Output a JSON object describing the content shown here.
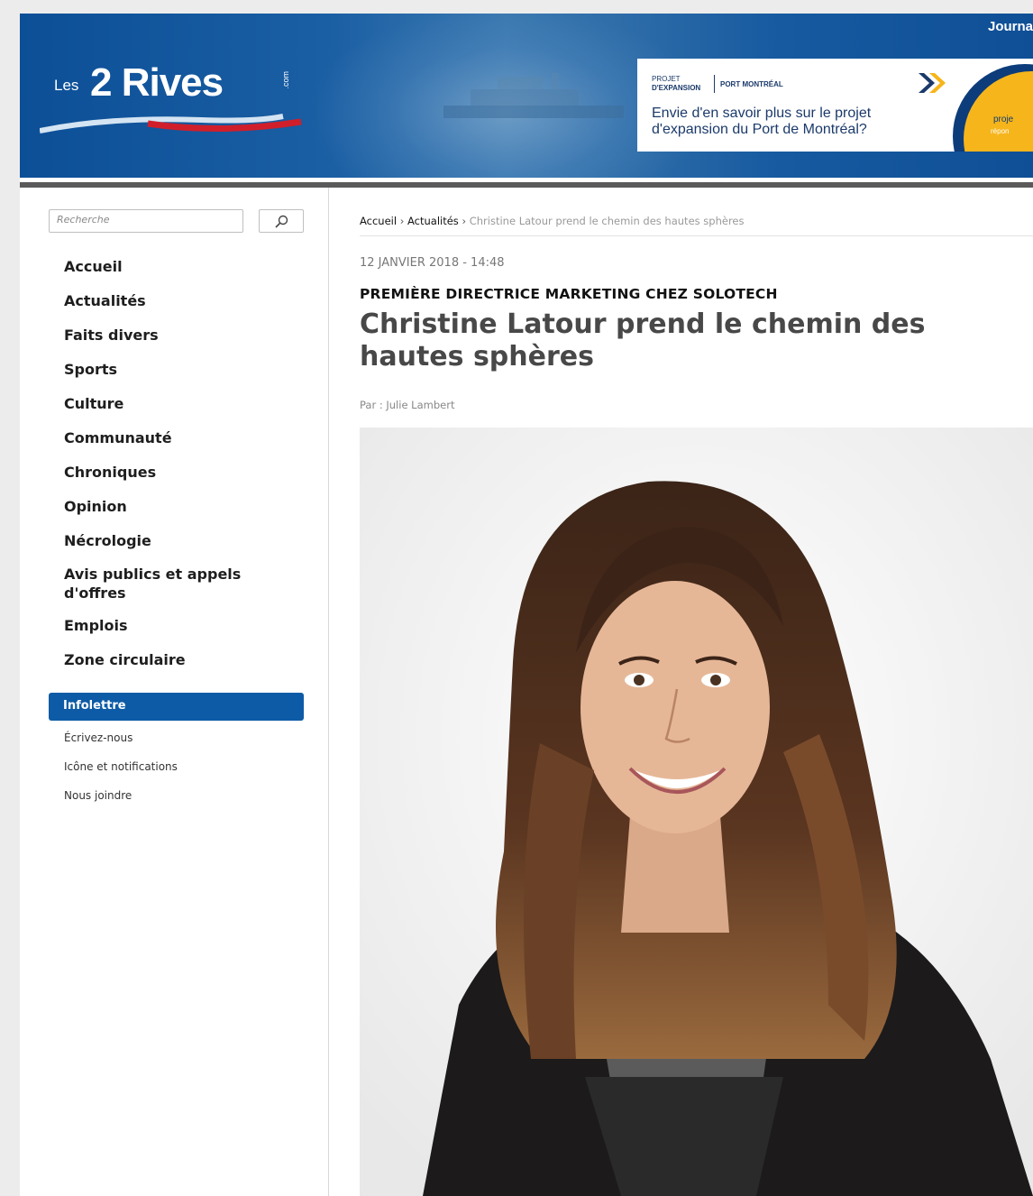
{
  "header": {
    "logo_les": "Les",
    "logo_main": "2 Rives",
    "logo_com": ".com",
    "top_right_label": "Journa",
    "ad": {
      "projet_line1": "PROJET",
      "projet_line2": "D'EXPANSION",
      "port_label": "PORT MONTRÉAL",
      "text": "Envie d'en savoir plus sur le projet d'expansion du Port de Montréal?",
      "circle_text1": "proje",
      "circle_text2": "répon"
    }
  },
  "sidebar": {
    "search_placeholder": "Recherche",
    "nav": [
      "Accueil",
      "Actualités",
      "Faits divers",
      "Sports",
      "Culture",
      "Communauté",
      "Chroniques",
      "Opinion",
      "Nécrologie",
      "Avis publics et appels d'offres",
      "Emplois",
      "Zone circulaire"
    ],
    "newsletter_label": "Infolettre",
    "sub": [
      "Écrivez-nous",
      "Icône et notifications",
      "Nous joindre"
    ]
  },
  "article": {
    "breadcrumb": [
      "Accueil",
      "Actualités",
      "Christine Latour prend le chemin des hautes sphères"
    ],
    "breadcrumb_sep": "›",
    "date": "12 JANVIER 2018 - 14:48",
    "kicker": "PREMIÈRE DIRECTRICE MARKETING CHEZ SOLOTECH",
    "title": "Christine Latour prend le chemin des hautes sphères",
    "byline": "Par : Julie Lambert"
  }
}
